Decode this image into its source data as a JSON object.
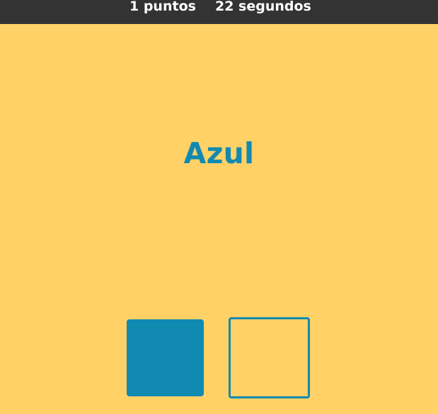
{
  "header": {
    "points_text": "1 puntos",
    "time_text": "22 segundos"
  },
  "game": {
    "word": "Azul",
    "choices": [
      {
        "name": "blue-square",
        "style": "filled"
      },
      {
        "name": "outlined-square",
        "style": "outline"
      }
    ]
  },
  "colors": {
    "background": "#ffd166",
    "topbar": "#333333",
    "accent_blue": "#118ab2",
    "topbar_text": "#ffffff"
  }
}
